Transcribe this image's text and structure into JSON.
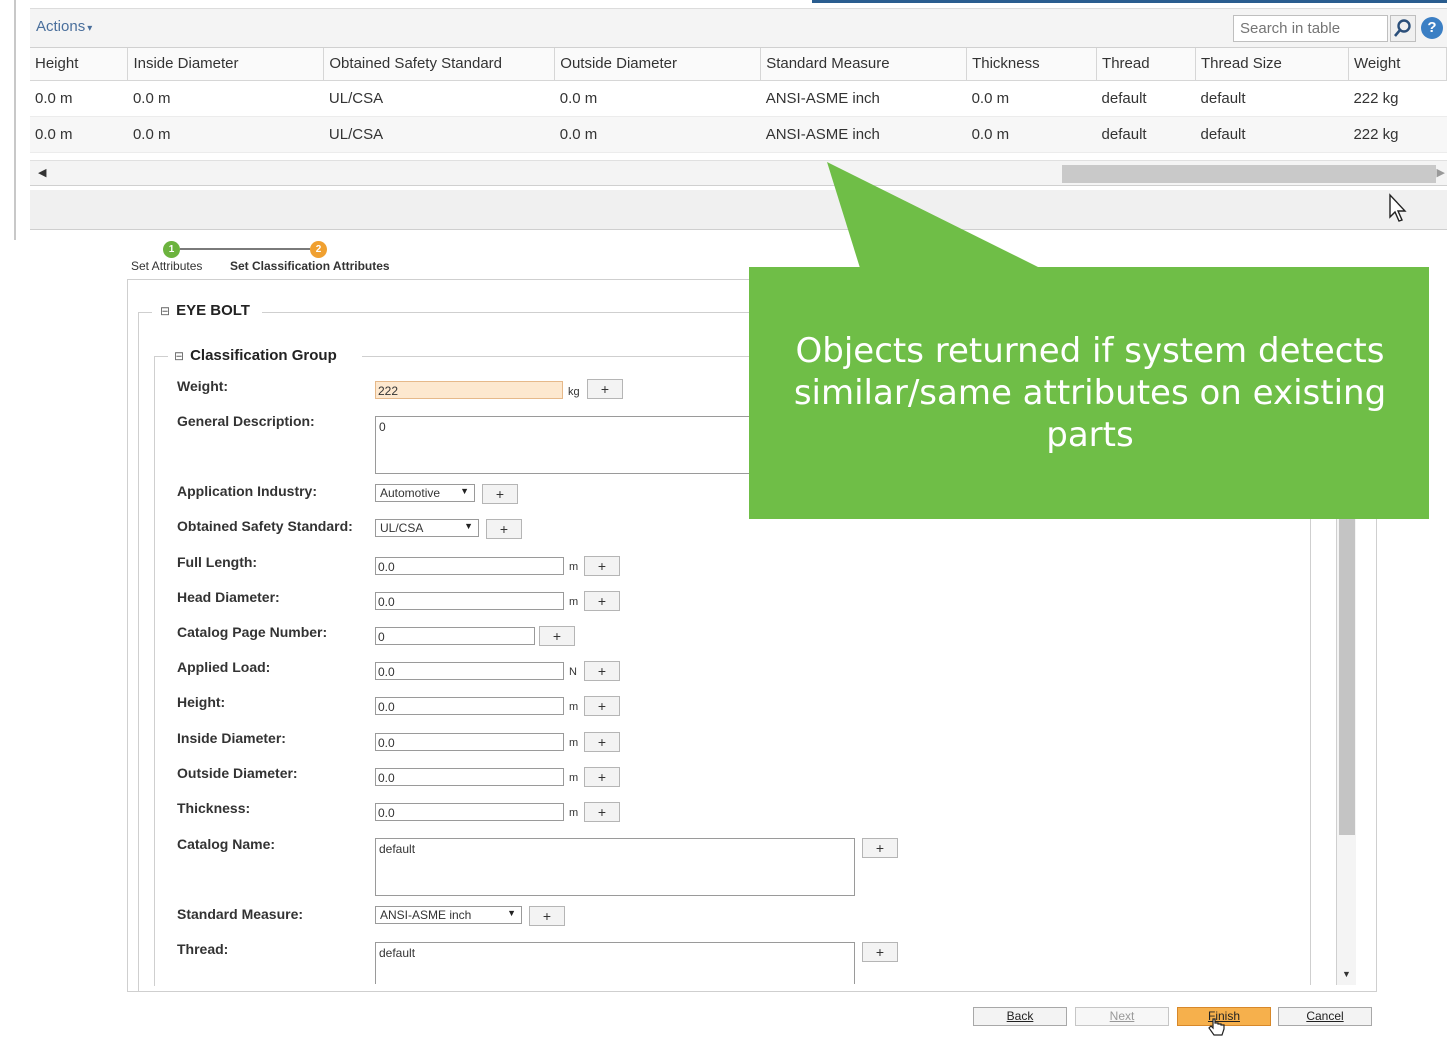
{
  "toolbar": {
    "actions_label": "Actions",
    "search_placeholder": "Search in table",
    "help_label": "?"
  },
  "results_table": {
    "columns": [
      "Height",
      "Inside Diameter",
      "Obtained Safety Standard",
      "Outside Diameter",
      "Standard Measure",
      "Thickness",
      "Thread",
      "Thread Size",
      "Weight"
    ],
    "rows": [
      [
        "0.0 m",
        "0.0 m",
        "UL/CSA",
        "0.0 m",
        "ANSI-ASME inch",
        "0.0 m",
        "default",
        "default",
        "222 kg"
      ],
      [
        "0.0 m",
        "0.0 m",
        "UL/CSA",
        "0.0 m",
        "ANSI-ASME inch",
        "0.0 m",
        "default",
        "default",
        "222 kg"
      ]
    ]
  },
  "wizard": {
    "steps": [
      {
        "number": "1",
        "label": "Set Attributes"
      },
      {
        "number": "2",
        "label": "Set Classification Attributes"
      }
    ],
    "section_title": "EYE BOLT",
    "group_title": "Classification Group",
    "fields": {
      "weight": {
        "label": "Weight:",
        "value": "222",
        "unit": "kg"
      },
      "general_description": {
        "label": "General Description:",
        "value": "0"
      },
      "application_industry": {
        "label": "Application Industry:",
        "value": "Automotive"
      },
      "obtained_safety_standard": {
        "label": "Obtained Safety Standard:",
        "value": "UL/CSA"
      },
      "full_length": {
        "label": "Full Length:",
        "value": "0.0",
        "unit": "m"
      },
      "head_diameter": {
        "label": "Head Diameter:",
        "value": "0.0",
        "unit": "m"
      },
      "catalog_page_number": {
        "label": "Catalog Page Number:",
        "value": "0"
      },
      "applied_load": {
        "label": "Applied Load:",
        "value": "0.0",
        "unit": "N"
      },
      "height": {
        "label": "Height:",
        "value": "0.0",
        "unit": "m"
      },
      "inside_diameter": {
        "label": "Inside Diameter:",
        "value": "0.0",
        "unit": "m"
      },
      "outside_diameter": {
        "label": "Outside Diameter:",
        "value": "0.0",
        "unit": "m"
      },
      "thickness": {
        "label": "Thickness:",
        "value": "0.0",
        "unit": "m"
      },
      "catalog_name": {
        "label": "Catalog Name:",
        "value": "default"
      },
      "standard_measure": {
        "label": "Standard Measure:",
        "value": "ANSI-ASME inch"
      },
      "thread": {
        "label": "Thread:",
        "value": "default"
      }
    },
    "add_label": "+",
    "buttons": {
      "back": "Back",
      "next": "Next",
      "finish": "Finish",
      "cancel": "Cancel"
    }
  },
  "callout": {
    "text": "Objects returned if system detects similar/same attributes on existing parts",
    "color": "#6fbe47"
  }
}
